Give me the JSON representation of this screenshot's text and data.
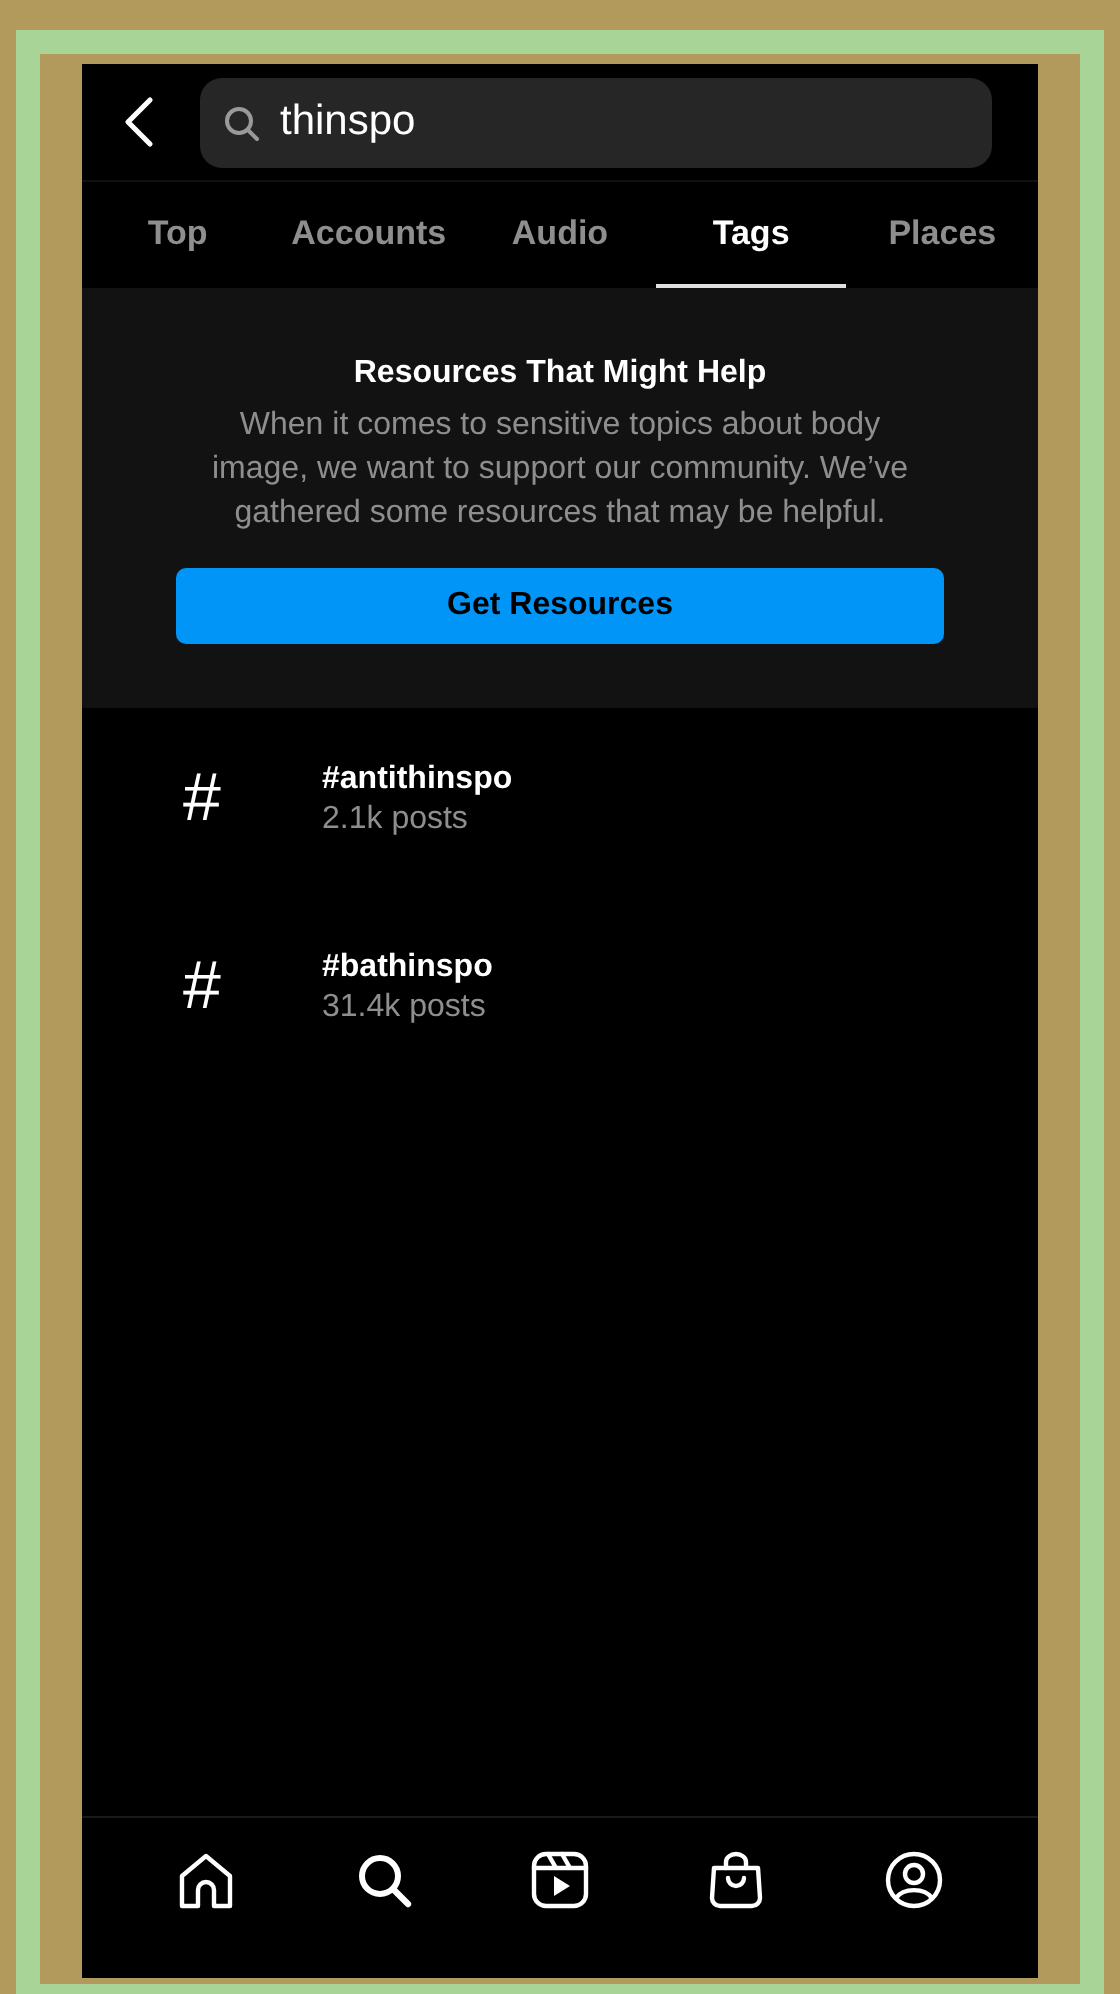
{
  "search": {
    "value": "thinspo"
  },
  "tabs": [
    {
      "label": "Top",
      "selected": false
    },
    {
      "label": "Accounts",
      "selected": false
    },
    {
      "label": "Audio",
      "selected": false
    },
    {
      "label": "Tags",
      "selected": true
    },
    {
      "label": "Places",
      "selected": false
    }
  ],
  "resources": {
    "title": "Resources That Might Help",
    "body": "When it comes to sensitive topics about body image, we want to support our community. We’ve gathered some resources that may be helpful.",
    "button": "Get Resources"
  },
  "tags": [
    {
      "symbol": "#",
      "name": "#antithinspo",
      "posts": "2.1k posts"
    },
    {
      "symbol": "#",
      "name": "#bathinspo",
      "posts": "31.4k posts"
    }
  ],
  "nav": [
    {
      "kind": "home"
    },
    {
      "kind": "search"
    },
    {
      "kind": "reels"
    },
    {
      "kind": "shop"
    },
    {
      "kind": "profile"
    }
  ]
}
